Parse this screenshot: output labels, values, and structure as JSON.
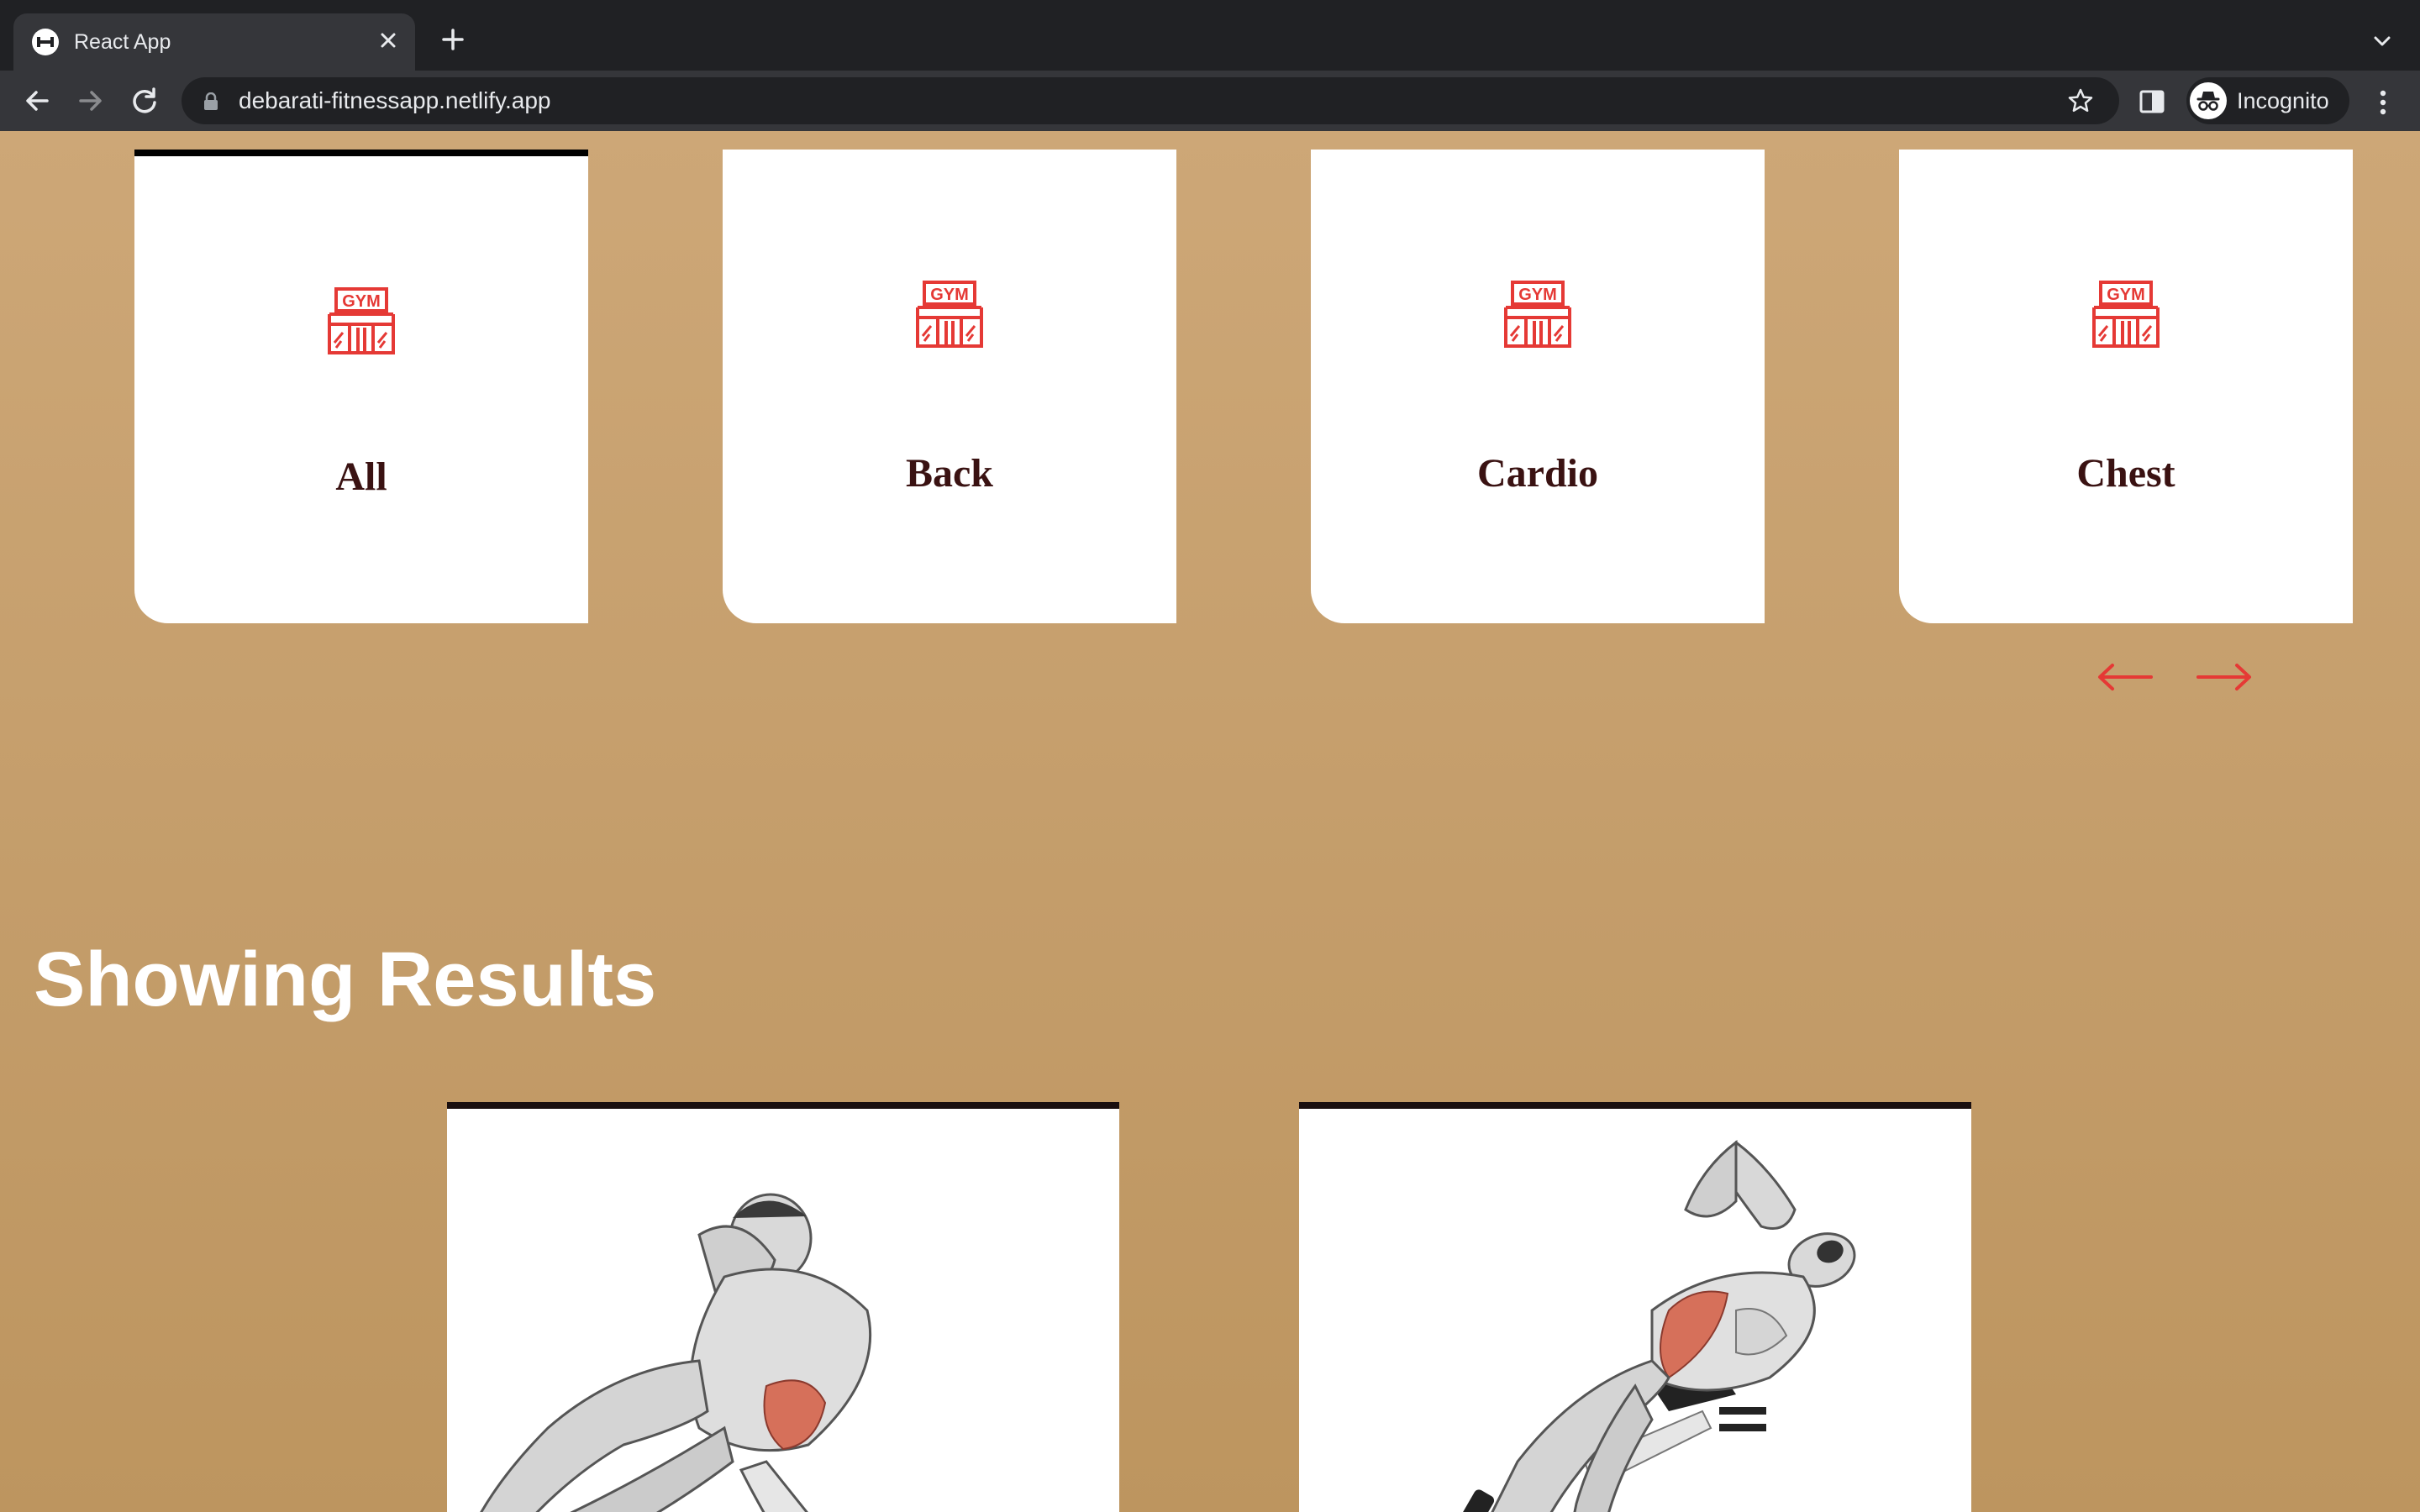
{
  "browser": {
    "tab_title": "React App",
    "url": "debarati-fitnessapp.netlify.app",
    "profile_label": "Incognito"
  },
  "icons": {
    "tab_favicon": "dumbbell-icon",
    "tab_close": "close-icon",
    "new_tab": "plus-icon",
    "tab_menu": "chevron-down-icon",
    "back": "arrow-left-icon",
    "forward": "arrow-right-icon",
    "reload": "reload-icon",
    "lock": "lock-icon",
    "bookmark": "star-icon",
    "side_panel": "side-panel-icon",
    "incognito": "incognito-icon",
    "menu": "kebab-menu-icon",
    "body_part": "gym-icon",
    "scroll_left": "arrow-left-icon",
    "scroll_right": "arrow-right-icon"
  },
  "body_parts": {
    "items": [
      {
        "label": "All",
        "active": true
      },
      {
        "label": "Back",
        "active": false
      },
      {
        "label": "Cardio",
        "active": false
      },
      {
        "label": "Chest",
        "active": false
      }
    ]
  },
  "results": {
    "heading": "Showing Results"
  },
  "colors": {
    "accent": "#e53935",
    "label": "#3a1212",
    "background_top": "#cda777",
    "background_bottom": "#bd955f",
    "card": "#ffffff"
  }
}
